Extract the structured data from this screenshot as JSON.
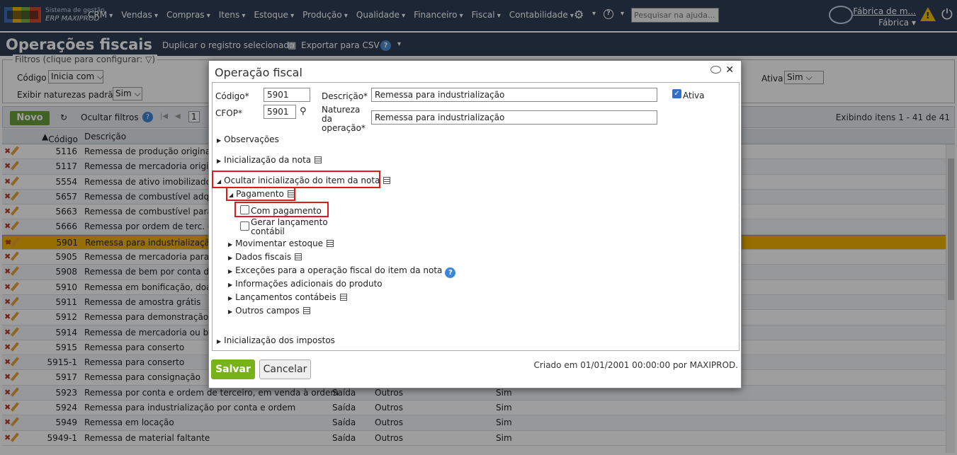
{
  "brand": {
    "line1": "Sistema de gestão",
    "line2": "ERP MAXIPROD"
  },
  "menu": [
    "CRM",
    "Vendas",
    "Compras",
    "Itens",
    "Estoque",
    "Produção",
    "Qualidade",
    "Financeiro",
    "Fiscal",
    "Contabilidade"
  ],
  "search": {
    "placeholder": "Pesquisar na ajuda..."
  },
  "company": {
    "name": "Fábrica de m...",
    "sub": "Fábrica"
  },
  "page": {
    "title": "Operações fiscais",
    "duplicate": "Duplicar o registro selecionado",
    "export": "Exportar para CSV"
  },
  "filters": {
    "legend": "Filtros (clique para configurar:",
    "codigo_label": "Código",
    "codigo_op": "Inicia com",
    "ativa_label": "Ativa",
    "ativa_value": "Sim",
    "exibir_label": "Exibir naturezas padrão",
    "exibir_value": "Sim"
  },
  "toolbar": {
    "novo": "Novo",
    "ocultar": "Ocultar filtros",
    "page": "1",
    "exibindo": "Exibindo itens 1 - 41 de 41"
  },
  "table": {
    "headers": {
      "codigo": "Código",
      "descricao": "Descrição"
    },
    "rows": [
      {
        "codigo": "5116",
        "descricao": "Remessa de produção originada",
        "tipo": "",
        "natureza": "",
        "ativa": ""
      },
      {
        "codigo": "5117",
        "descricao": "Remessa de mercadoria originad",
        "tipo": "",
        "natureza": "",
        "ativa": ""
      },
      {
        "codigo": "5554",
        "descricao": "Remessa de ativo imobilizado p/",
        "tipo": "",
        "natureza": "",
        "ativa": ""
      },
      {
        "codigo": "5657",
        "descricao": "Remessa de combustível adq. de",
        "tipo": "",
        "natureza": "",
        "ativa": ""
      },
      {
        "codigo": "5663",
        "descricao": "Remessa de combustível para ar",
        "tipo": "",
        "natureza": "",
        "ativa": ""
      },
      {
        "codigo": "5666",
        "descricao": "Remessa por ordem de terc. de",
        "tipo": "",
        "natureza": "",
        "ativa": ""
      },
      {
        "codigo": "5901",
        "descricao": "Remessa para industrialização",
        "tipo": "",
        "natureza": "",
        "ativa": ""
      },
      {
        "codigo": "5905",
        "descricao": "Remessa de mercadoria para arr",
        "tipo": "",
        "natureza": "",
        "ativa": ""
      },
      {
        "codigo": "5908",
        "descricao": "Remessa de bem por conta de c",
        "tipo": "",
        "natureza": "",
        "ativa": ""
      },
      {
        "codigo": "5910",
        "descricao": "Remessa em bonificação, doação",
        "tipo": "",
        "natureza": "",
        "ativa": ""
      },
      {
        "codigo": "5911",
        "descricao": "Remessa de amostra grátis",
        "tipo": "",
        "natureza": "",
        "ativa": ""
      },
      {
        "codigo": "5912",
        "descricao": "Remessa para demonstração",
        "tipo": "",
        "natureza": "",
        "ativa": ""
      },
      {
        "codigo": "5914",
        "descricao": "Remessa de mercadoria ou bem",
        "tipo": "",
        "natureza": "",
        "ativa": ""
      },
      {
        "codigo": "5915",
        "descricao": "Remessa para conserto",
        "tipo": "",
        "natureza": "",
        "ativa": ""
      },
      {
        "codigo": "5915-1",
        "descricao": "Remessa para conserto",
        "tipo": "",
        "natureza": "",
        "ativa": ""
      },
      {
        "codigo": "5917",
        "descricao": "Remessa para consignação",
        "tipo": "",
        "natureza": "",
        "ativa": ""
      },
      {
        "codigo": "5923",
        "descricao": "Remessa por conta e ordem de terceiro, em venda à ordem",
        "tipo": "Saída",
        "natureza": "Outros",
        "ativa": "Sim"
      },
      {
        "codigo": "5924",
        "descricao": "Remessa para industrialização por conta e ordem",
        "tipo": "Saída",
        "natureza": "Outros",
        "ativa": "Sim"
      },
      {
        "codigo": "5949",
        "descricao": "Remessa em locação",
        "tipo": "Saída",
        "natureza": "Outros",
        "ativa": "Sim"
      },
      {
        "codigo": "5949-1",
        "descricao": "Remessa de material faltante",
        "tipo": "Saída",
        "natureza": "Outros",
        "ativa": "Sim"
      }
    ]
  },
  "dialog": {
    "title": "Operação fiscal",
    "codigo_label": "Código*",
    "codigo_value": "5901",
    "cfop_label": "CFOP*",
    "cfop_value": "5901",
    "descricao_label": "Descrição*",
    "descricao_value": "Remessa para industrialização",
    "natureza_label_1": "Natureza",
    "natureza_label_2": "da",
    "natureza_label_3": "operação*",
    "natureza_value": "Remessa para industrialização",
    "ativa_label": "Ativa",
    "sections": {
      "observacoes": "Observações",
      "inicializacao_nota": "Inicialização da nota",
      "ocultar_item": "Ocultar inicialização do item da nota",
      "pagamento": "Pagamento",
      "com_pagamento": "Com pagamento",
      "gerar_lanc_1": "Gerar lançamento",
      "gerar_lanc_2": "contábil",
      "movimentar": "Movimentar estoque",
      "dados_fiscais": "Dados fiscais",
      "excecoes": "Exceções para a operação fiscal do item da nota",
      "info_adic": "Informações adicionais do produto",
      "lancamentos": "Lançamentos contábeis",
      "outros": "Outros campos",
      "impostos": "Inicialização dos impostos"
    },
    "save": "Salvar",
    "cancel": "Cancelar",
    "created": "Criado em 01/01/2001 00:00:00 por MAXIPROD."
  },
  "colors": {
    "nav": "#2e3e55",
    "selected_row": "#f0b400",
    "save": "#77b21b",
    "highlight": "#e0191f"
  }
}
